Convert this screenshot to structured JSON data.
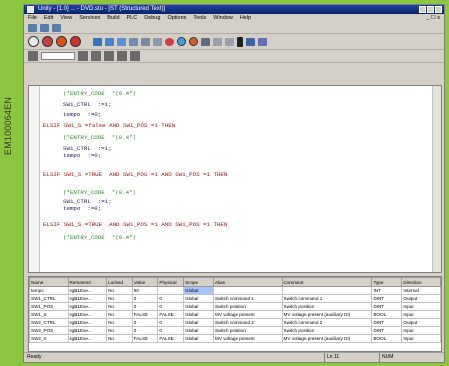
{
  "side_code": "EM100064EN",
  "window": {
    "title": "Unity - [1.0] ... - DVD.stu - [ST (Structured Text)]",
    "menu": [
      "File",
      "Edit",
      "View",
      "Services",
      "Build",
      "PLC",
      "Debug",
      "Options",
      "Tools",
      "Window",
      "Help"
    ],
    "mdi_controls": "_ ☐ x"
  },
  "toolbar": {
    "step_field": ""
  },
  "code_lines": [
    {
      "text": "(*ENTRY_CODE  *(0.4*)",
      "type": "comment"
    },
    {
      "text": "SW1_CTRL  :=1;",
      "type": "code"
    },
    {
      "text": "tempo  :=0;",
      "type": "code"
    },
    {
      "text": "ELSIF SW1_S =false AND SW1_POS =1 THEN",
      "type": "keyword"
    },
    {
      "text": "(*ENTRY_CODE  *(0.4*)",
      "type": "comment"
    },
    {
      "text": "SW1_CTRL  :=1;",
      "type": "code"
    },
    {
      "text": "tempo  :=0;",
      "type": "code"
    },
    {
      "text": "ELSIF SW1_S =TRUE  AND SW1_POS =1 AND SW1_POS =1 THEN",
      "type": "keyword"
    },
    {
      "text": "(*ENTRY_CODE  *(0.4*)",
      "type": "comment"
    },
    {
      "text": "SW1_CTRL  :=1;",
      "type": "code"
    },
    {
      "text": "tempo  :=0;",
      "type": "code"
    },
    {
      "text": "ELSIF SW1_S =TRUE  AND SW1_POS =1 AND SW1_POS =1 THEN",
      "type": "keyword"
    },
    {
      "text": "(*ENTRY_CODE  *(0.4*)",
      "type": "comment"
    }
  ],
  "var_table": {
    "headers": [
      "Name",
      "Remanent",
      "Locked",
      "Value",
      "Physical",
      "Scope",
      "Alias",
      "Comment",
      "Type",
      "Direction"
    ],
    "rows": [
      [
        "tempo",
        "sgB1Exe...",
        "No",
        "60",
        "",
        "Global",
        "",
        "",
        "INT",
        "Internal"
      ],
      [
        "SW1_CTRL",
        "sgB1Exe...",
        "No",
        "0",
        "0",
        "Global",
        "Switch command 1",
        "Switch command 1",
        "DINT",
        "Output"
      ],
      [
        "SW1_POS",
        "sgB1Exe...",
        "No",
        "0",
        "0",
        "Global",
        "Switch position",
        "Switch position",
        "DINT",
        "Input"
      ],
      [
        "SW1_S",
        "sgB1Exe...",
        "No",
        "FALSE",
        "FALSE",
        "Global",
        "MV voltage present",
        "MV voltage present (auxiliary DI)",
        "BOOL",
        "Input"
      ],
      [
        "SW2_CTRL",
        "sgB1Exe...",
        "No",
        "0",
        "0",
        "Global",
        "Switch command 2",
        "Switch command 2",
        "DINT",
        "Output"
      ],
      [
        "SW2_POS",
        "sgB1Exe...",
        "No",
        "0",
        "0",
        "Global",
        "Switch position",
        "Switch position",
        "DINT",
        "Input"
      ],
      [
        "SW2_S",
        "sgB1Exe...",
        "No",
        "FALSE",
        "FALSE",
        "Global",
        "MV voltage present",
        "MV voltage present (auxiliary DI)",
        "BOOL",
        "Input"
      ]
    ],
    "highlight": "Global"
  },
  "status": {
    "left": "Ready",
    "pos": "Ln 11",
    "mode": "NUM"
  }
}
